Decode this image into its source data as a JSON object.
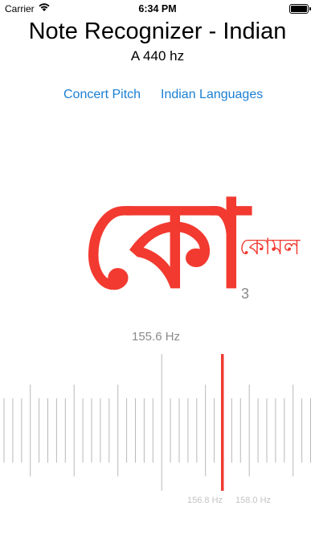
{
  "status_bar": {
    "carrier": "Carrier",
    "time": "6:34 PM"
  },
  "header": {
    "title": "Note Recognizer - Indian",
    "reference": "A 440 hz"
  },
  "mode_buttons": {
    "concert": "Concert Pitch",
    "indian": "Indian Languages"
  },
  "note": {
    "symbol": "কো",
    "name": "কোমল",
    "octave": "3"
  },
  "frequency": {
    "detected": "155.6 Hz"
  },
  "scale": {
    "left_label": "156.8 Hz",
    "right_label": "158.0 Hz"
  },
  "colors": {
    "accent": "#f23a30",
    "link": "#1a7fd3",
    "tick": "#b9b9b9",
    "text_muted": "#8a8a8a"
  }
}
